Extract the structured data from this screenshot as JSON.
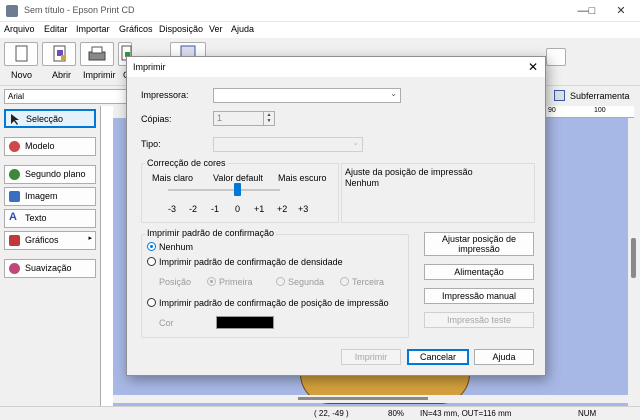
{
  "app": {
    "title": "Sem título - Epson Print CD",
    "window_controls": {
      "minimize": "—",
      "maximize": "□",
      "close": "✕"
    },
    "menu": [
      "Arquivo",
      "Editar",
      "Importar",
      "Gráficos",
      "Disposição",
      "Ver",
      "Ajuda"
    ],
    "toolbar_labels": [
      "Novo",
      "Abrir",
      "Imprimir",
      "G"
    ],
    "font_select": "Arial",
    "subtools_label": "Subferramenta",
    "left_panel": [
      {
        "label": "Selecção",
        "icon": "arrow-icon",
        "color": "#333333"
      },
      {
        "label": "Modelo",
        "icon": "template-icon",
        "color": "#d14848"
      },
      {
        "label": "Segundo plano",
        "icon": "background-icon",
        "color": "#3a8a3a"
      },
      {
        "label": "Imagem",
        "icon": "image-icon",
        "color": "#3a6ec0"
      },
      {
        "label": "Texto",
        "icon": "text-icon",
        "color": "#2a4fb0"
      },
      {
        "label": "Gráficos",
        "icon": "graphics-icon",
        "color": "#c03a3a"
      },
      {
        "label": "Suavização",
        "icon": "smoothing-icon",
        "color": "#c04878"
      }
    ],
    "ruler_marks": [
      "90",
      "100"
    ],
    "status": {
      "coords": "( 22, -49 )",
      "zoom": "80%",
      "diameters": "IN=43 mm, OUT=116 mm",
      "numlock": "NUM"
    }
  },
  "dialog": {
    "title": "Imprimir",
    "close": "✕",
    "printer_label": "Impressora:",
    "printer_value": "",
    "copies_label": "Cópias:",
    "copies_value": "1",
    "type_label": "Tipo:",
    "type_value": "",
    "color_correction": {
      "legend": "Correcção de cores",
      "lighter": "Mais claro",
      "default": "Valor default",
      "darker": "Mais escuro",
      "ticks": [
        "-3",
        "-2",
        "-1",
        "0",
        "+1",
        "+2",
        "+3"
      ],
      "selected": "0"
    },
    "adjust_info": {
      "title": "Ajuste da posição de impressão",
      "value": "Nenhum"
    },
    "check_pattern": {
      "legend": "Imprimir padrão de confirmação",
      "none": "Nenhum",
      "density": "Imprimir padrão de confirmação de densidade",
      "position_label": "Posição",
      "positions": [
        "Primeira",
        "Segunda",
        "Terceira"
      ],
      "print_position": "Imprimir padrão de confirmação de posição de impressão",
      "color_label": "Cor",
      "selected": "Nenhum"
    },
    "side_buttons": {
      "adjust": "Ajustar posição de impressão",
      "feed": "Alimentação",
      "manual": "Impressão manual",
      "test": "Impressão teste"
    },
    "footer_buttons": {
      "print": "Imprimir",
      "cancel": "Cancelar",
      "help": "Ajuda"
    },
    "colors": {
      "accent": "#0078d7",
      "swatch": "#000000"
    }
  }
}
